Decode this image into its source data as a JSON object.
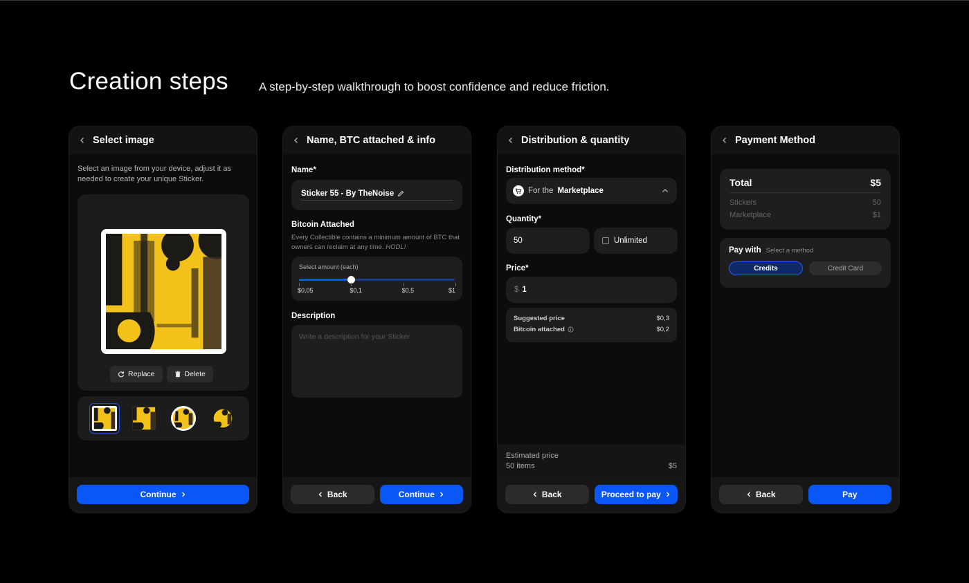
{
  "page": {
    "title": "Creation steps",
    "subtitle": "A step-by-step walkthrough to boost confidence and reduce friction."
  },
  "colors": {
    "accent": "#0a57f5",
    "background": "#000000",
    "card": "#1e1e1e",
    "sticker_yellow": "#f2c21b"
  },
  "step1": {
    "title": "Select image",
    "intro": "Select an image from your device, adjust it as needed to create your unique Sticker.",
    "replace_label": "Replace",
    "delete_label": "Delete",
    "continue_label": "Continue",
    "icons": [
      "chevron-left-icon",
      "refresh-icon",
      "trash-icon",
      "chevron-right-icon"
    ]
  },
  "step2": {
    "title": "Name, BTC attached & info",
    "name_label": "Name*",
    "name_value": "Sticker 55 - By TheNoise",
    "btc_label": "Bitcoin Attached",
    "btc_hint": "Every Collectible contains a minimum amount of BTC that owners can reclaim at any time.",
    "btc_hint_em": "HODL!",
    "slider_label": "Select amount (each)",
    "slider_ticks": [
      "$0,05",
      "$0,1",
      "$0,5",
      "$1"
    ],
    "slider_selected": "$0,1",
    "description_label": "Description",
    "description_placeholder": "Write a description for your Sticker",
    "back_label": "Back",
    "continue_label": "Continue"
  },
  "step3": {
    "title": "Distribution & quantity",
    "method_label": "Distribution method*",
    "method_prefix": "For the",
    "method_value": "Marketplace",
    "quantity_label": "Quantity*",
    "quantity_value": "50",
    "unlimited_label": "Unlimited",
    "unlimited_checked": false,
    "price_label": "Price*",
    "price_currency": "$",
    "price_value": "1",
    "suggested_label": "Suggested price",
    "suggested_value": "$0,3",
    "btc_attached_label": "Bitcoin attached",
    "btc_attached_value": "$0,2",
    "estimated_label": "Estimated price",
    "estimated_items": "50 items",
    "estimated_value": "$5",
    "back_label": "Back",
    "proceed_label": "Proceed to pay"
  },
  "step4": {
    "title": "Payment Method",
    "total_label": "Total",
    "total_value": "$5",
    "lines": [
      {
        "label": "Stickers",
        "value": "50"
      },
      {
        "label": "Marketplace",
        "value": "$1"
      }
    ],
    "pay_with_label": "Pay with",
    "pay_with_hint": "Select a method",
    "methods": [
      "Credits",
      "Credit Card"
    ],
    "selected_method": "Credits",
    "back_label": "Back",
    "pay_label": "Pay"
  }
}
